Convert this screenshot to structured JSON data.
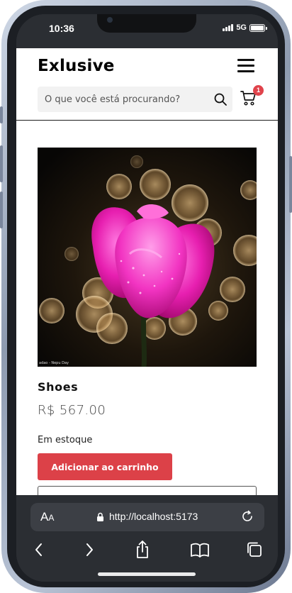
{
  "status_bar": {
    "time": "10:36",
    "network": "5G"
  },
  "header": {
    "brand": "Exlusive",
    "search_placeholder": "O que você está procurando?",
    "cart_count": "1"
  },
  "product": {
    "name": "Shoes",
    "price": "R$ 567.00",
    "stock_status": "Em estoque",
    "add_to_cart_label": "Adicionar ao carrinho",
    "image_caption": "adao - Nepu Day"
  },
  "browser": {
    "text_size_label": "A",
    "text_size_label_big": "A",
    "url": "http://localhost:5173"
  },
  "colors": {
    "accent": "#dc4148",
    "browser_chrome": "#2b2e33"
  }
}
